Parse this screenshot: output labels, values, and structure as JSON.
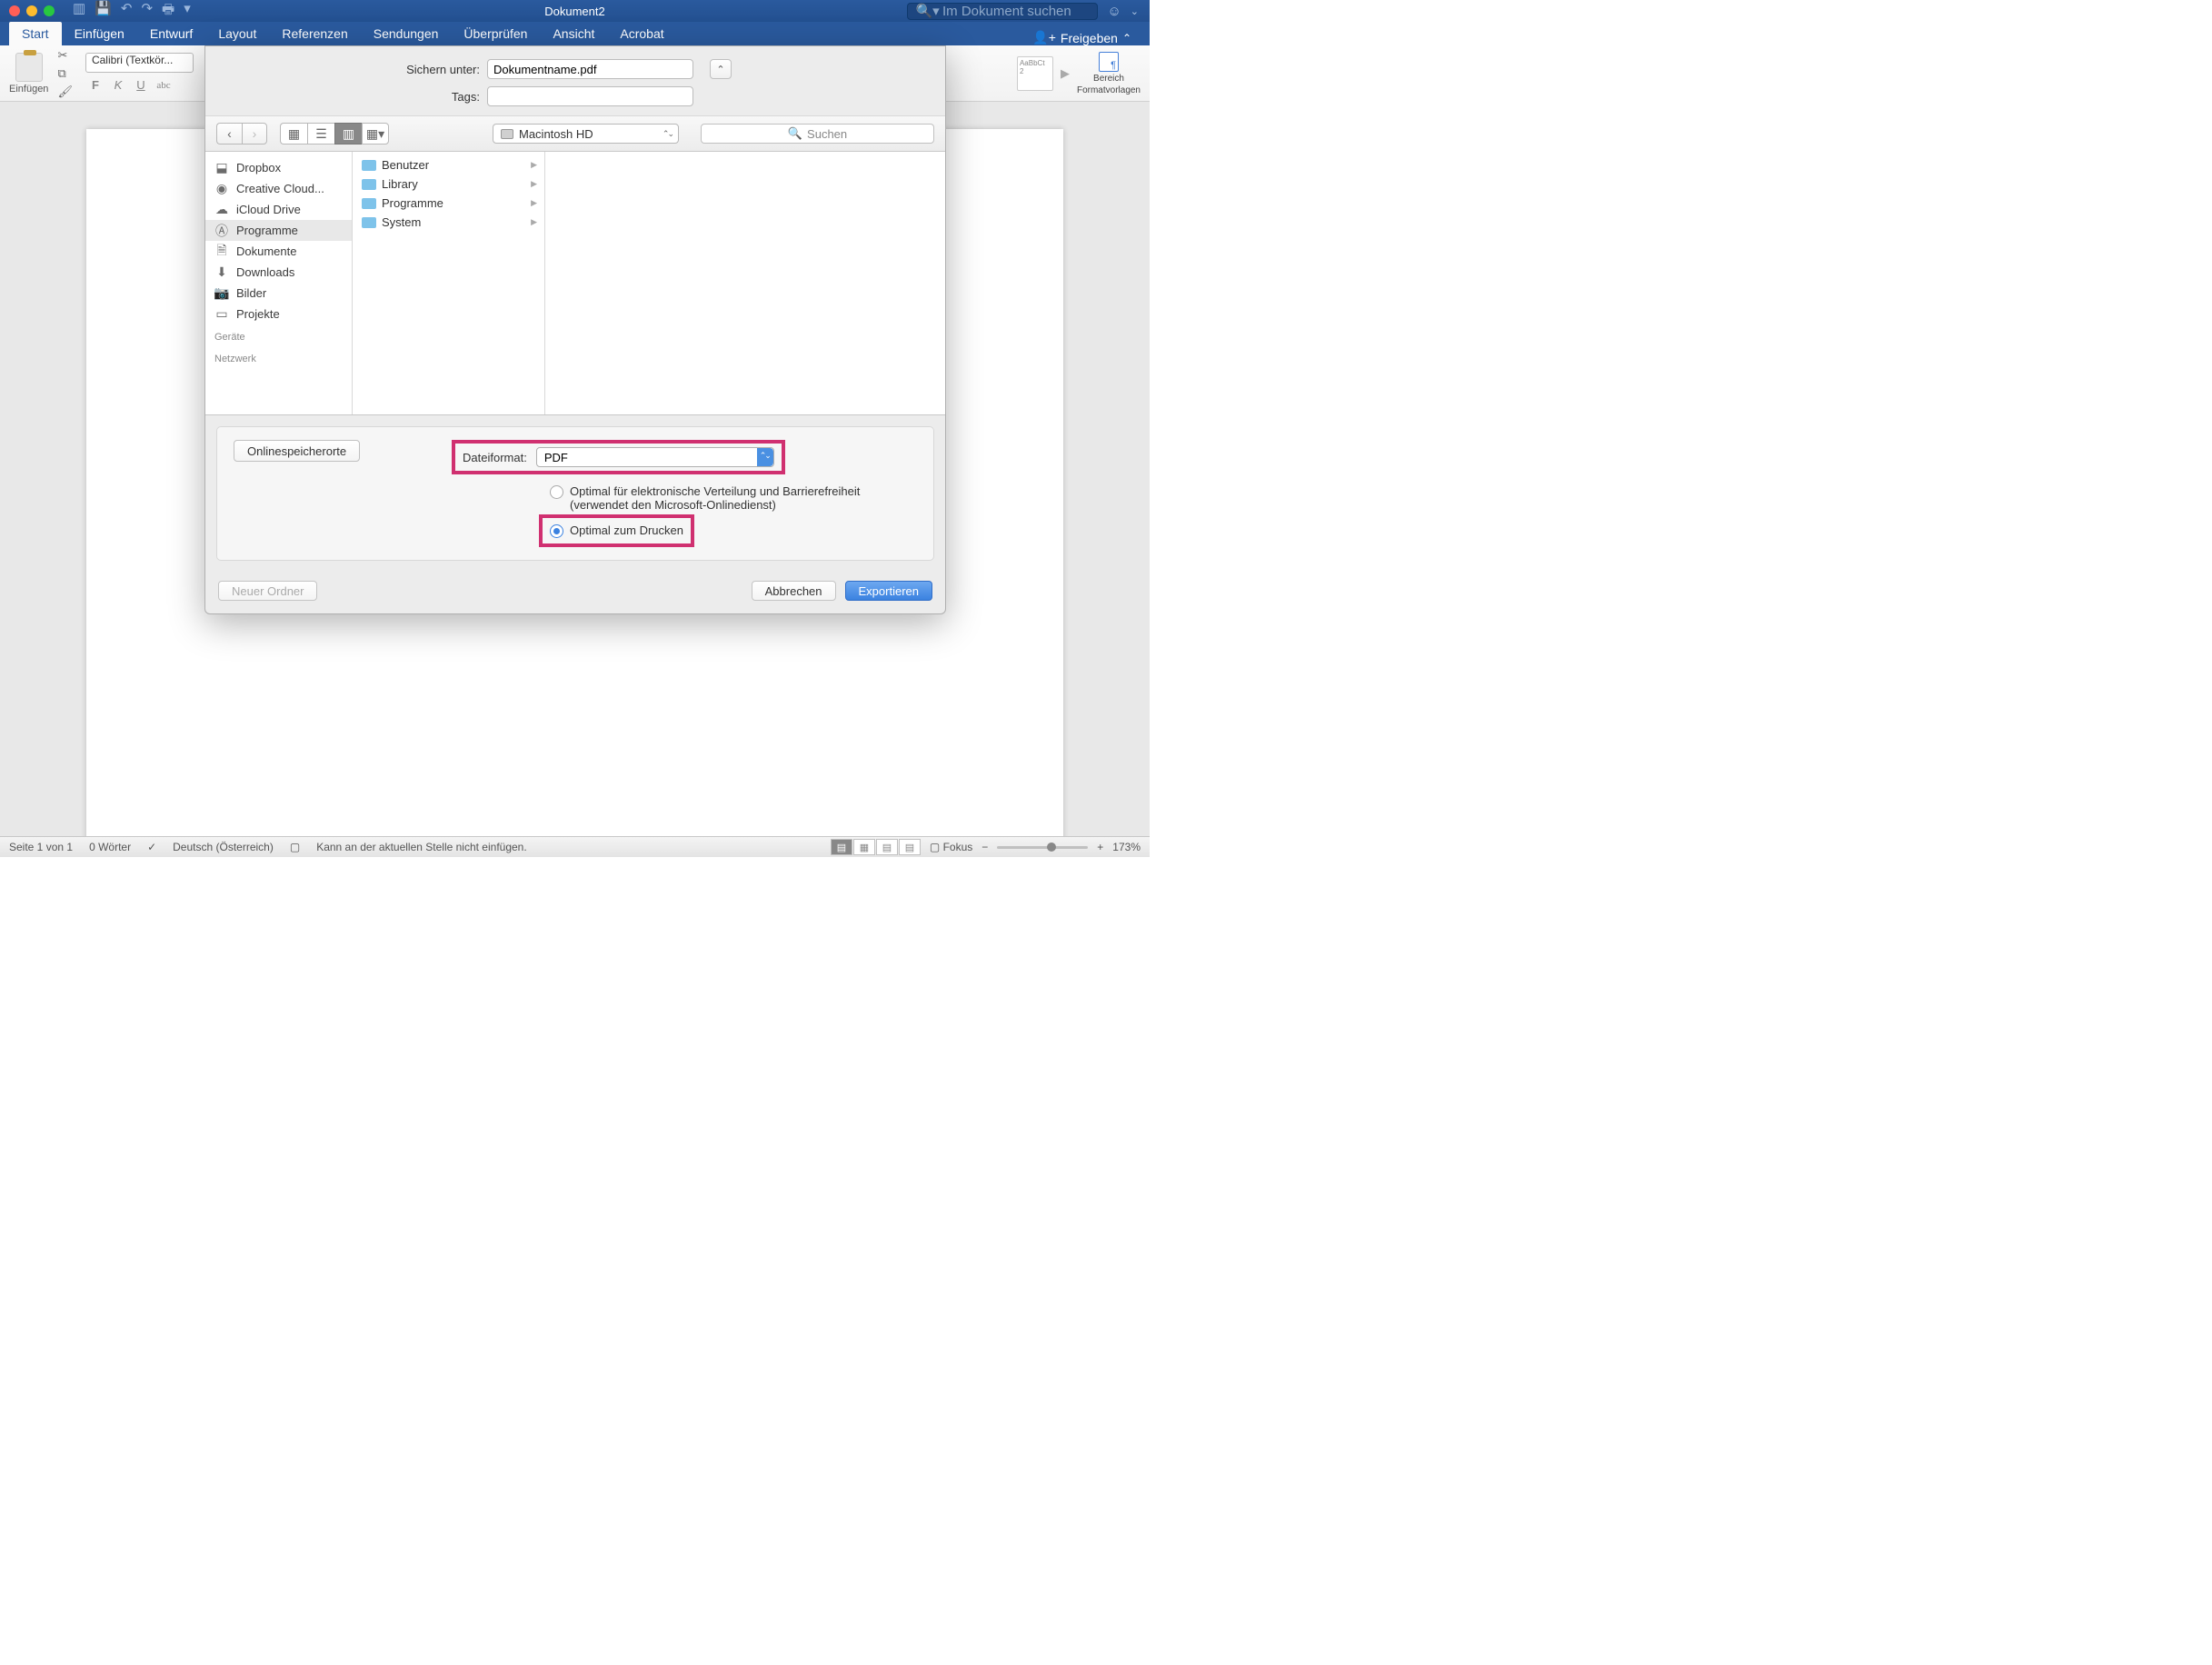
{
  "titlebar": {
    "title": "Dokument2",
    "search_placeholder": "Im Dokument suchen"
  },
  "tabs": {
    "items": [
      "Start",
      "Einfügen",
      "Entwurf",
      "Layout",
      "Referenzen",
      "Sendungen",
      "Überprüfen",
      "Ansicht",
      "Acrobat"
    ],
    "active": "Start",
    "share": "Freigeben"
  },
  "ribbon": {
    "paste": "Einfügen",
    "font": "Calibri (Textkör...",
    "styles_pane_l1": "Bereich",
    "styles_pane_l2": "Formatvorlagen",
    "style_thumb": "AaBbCt 2"
  },
  "dialog": {
    "save_as_label": "Sichern unter:",
    "filename": "Dokumentname.pdf",
    "tags_label": "Tags:",
    "tags_value": "",
    "location_label": "Macintosh HD",
    "search_placeholder": "Suchen",
    "sidebar": {
      "favorites": [
        {
          "icon": "dropbox",
          "label": "Dropbox"
        },
        {
          "icon": "cc",
          "label": "Creative Cloud..."
        },
        {
          "icon": "cloud",
          "label": "iCloud Drive"
        },
        {
          "icon": "apps",
          "label": "Programme"
        },
        {
          "icon": "docs",
          "label": "Dokumente"
        },
        {
          "icon": "dl",
          "label": "Downloads"
        },
        {
          "icon": "pics",
          "label": "Bilder"
        },
        {
          "icon": "folder",
          "label": "Projekte"
        }
      ],
      "devices_header": "Geräte",
      "network_header": "Netzwerk"
    },
    "folders": [
      "Benutzer",
      "Library",
      "Programme",
      "System"
    ],
    "online_storage": "Onlinespeicherorte",
    "format_label": "Dateiformat:",
    "format_value": "PDF",
    "radio1_l1": "Optimal für elektronische Verteilung und Barrierefreiheit",
    "radio1_l2": "(verwendet den Microsoft-Onlinedienst)",
    "radio2": "Optimal zum Drucken",
    "new_folder": "Neuer Ordner",
    "cancel": "Abbrechen",
    "export": "Exportieren"
  },
  "statusbar": {
    "page": "Seite 1 von 1",
    "words": "0 Wörter",
    "lang": "Deutsch (Österreich)",
    "insert_msg": "Kann an der aktuellen Stelle nicht einfügen.",
    "focus": "Fokus",
    "zoom": "173%"
  }
}
